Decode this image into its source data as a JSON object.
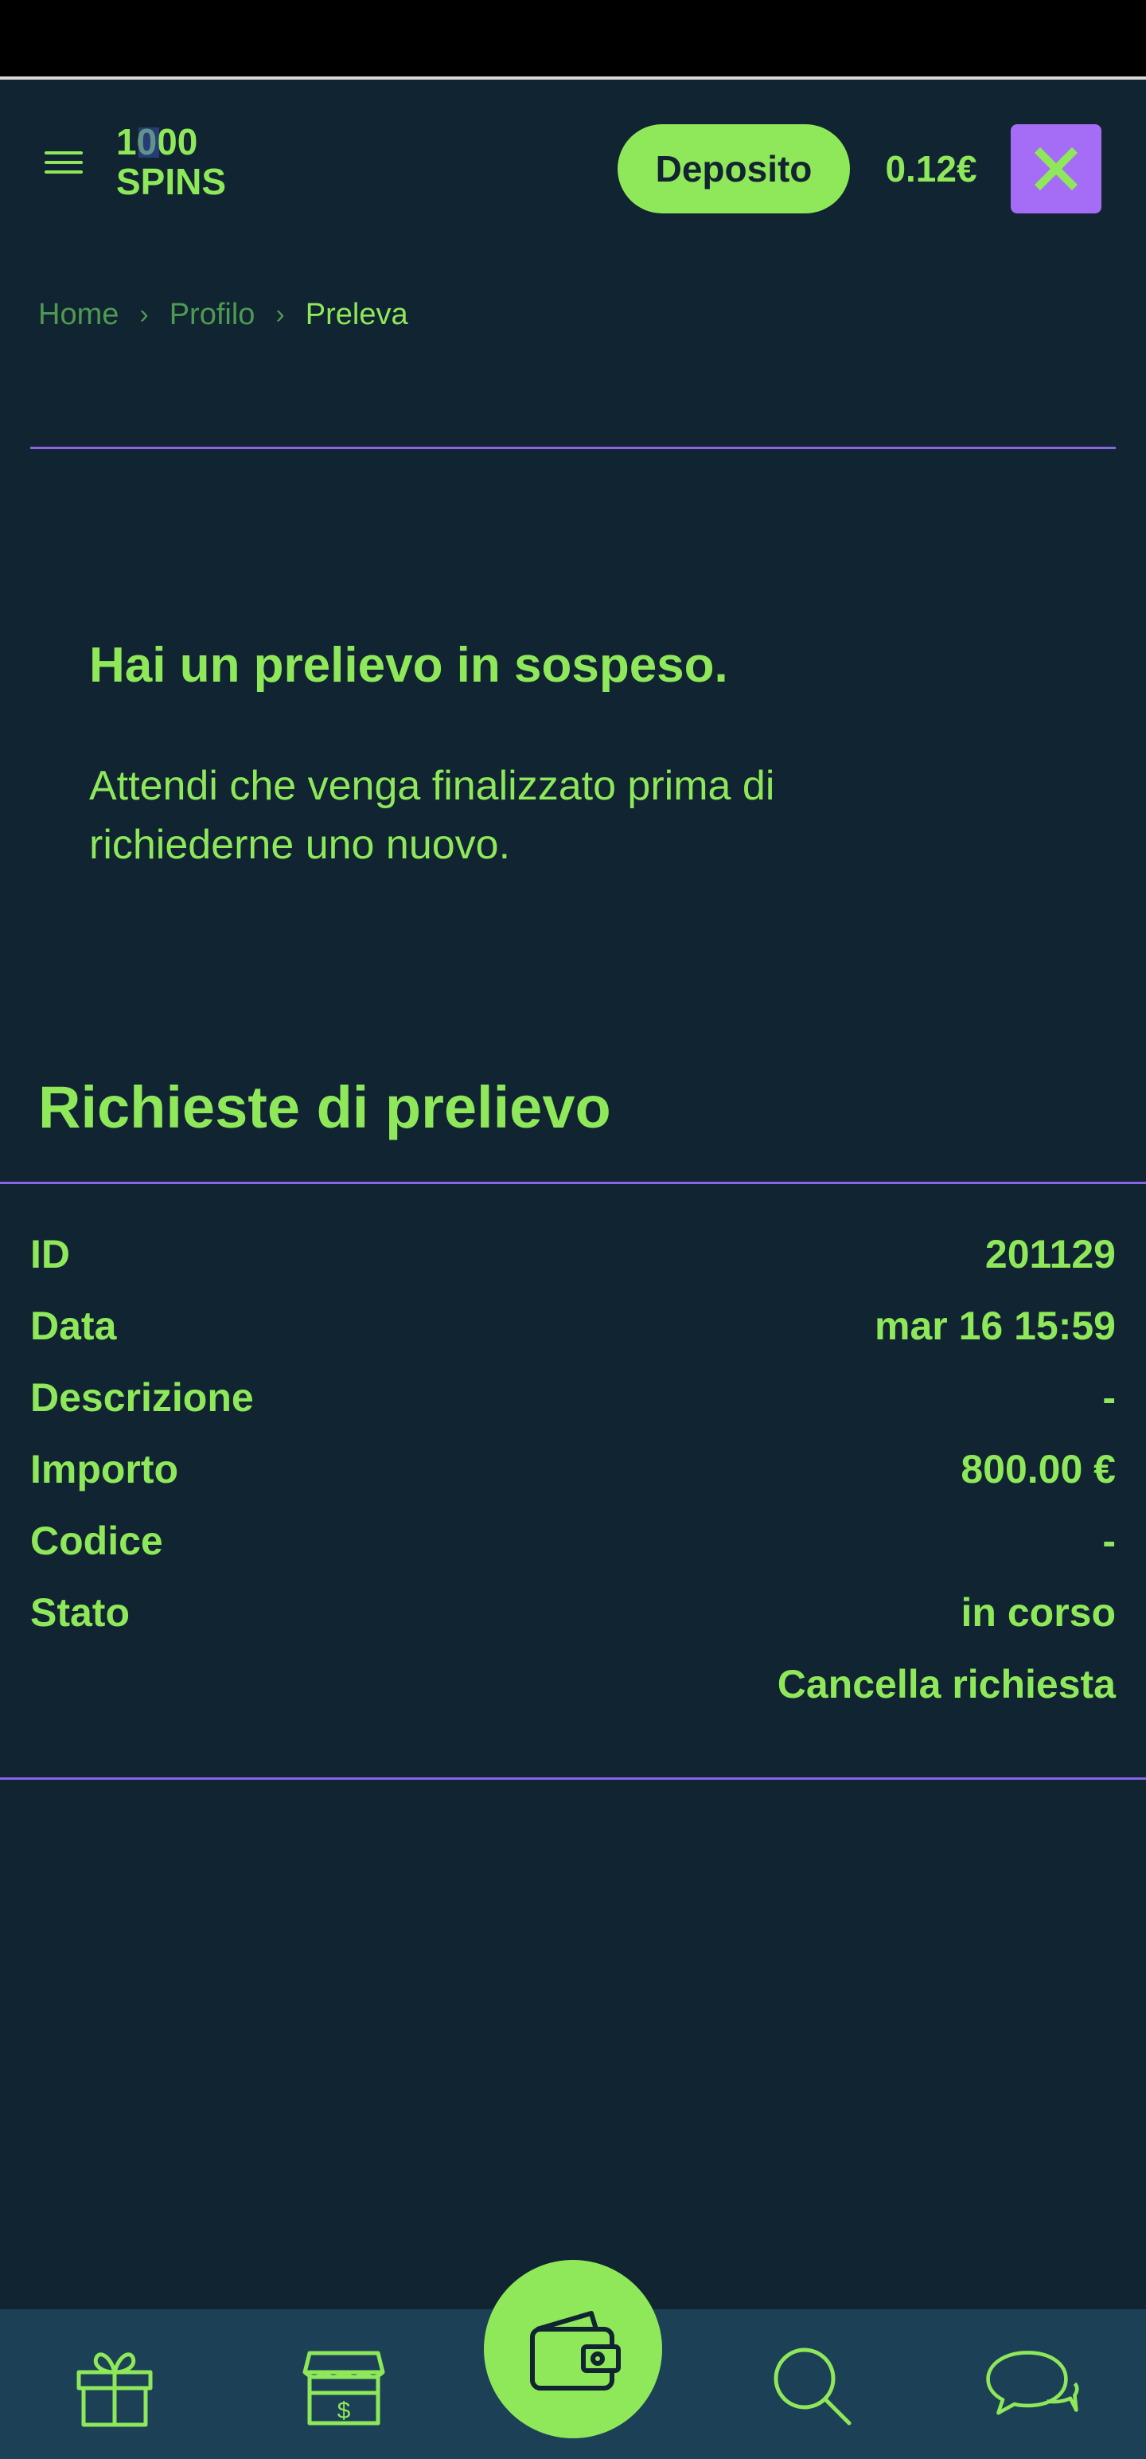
{
  "header": {
    "logo_top": "1000",
    "logo_bottom": "SPINS",
    "deposit_label": "Deposito",
    "balance": "0.12€"
  },
  "breadcrumb": {
    "items": [
      "Home",
      "Profilo",
      "Preleva"
    ]
  },
  "notice": {
    "title": "Hai un prelievo in sospeso.",
    "text": "Attendi che venga finalizzato prima di richiederne uno nuovo."
  },
  "withdrawals": {
    "title": "Richieste di prelievo",
    "rows": [
      {
        "label": "ID",
        "value": "201129"
      },
      {
        "label": "Data",
        "value": "mar 16 15:59"
      },
      {
        "label": "Descrizione",
        "value": "-"
      },
      {
        "label": "Importo",
        "value": "800.00 €"
      },
      {
        "label": "Codice",
        "value": "-"
      },
      {
        "label": "Stato",
        "value": "in corso"
      }
    ],
    "cancel_label": "Cancella richiesta"
  },
  "bottom_nav": {
    "items": [
      "gift-icon",
      "shop-icon",
      "wallet-icon",
      "search-icon",
      "chat-icon"
    ]
  },
  "colors": {
    "background": "#112431",
    "accent_green": "#8ee85a",
    "accent_purple": "#a56cf5",
    "divider": "#8b63e8",
    "nav_background": "#1c4156"
  }
}
